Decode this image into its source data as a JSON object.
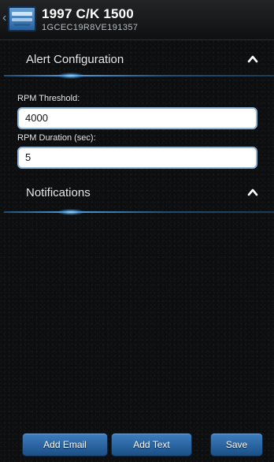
{
  "header": {
    "vehicle_name": "1997 C/K 1500",
    "vin": "1GCEC19R8VE191357"
  },
  "sections": {
    "alert_configuration": {
      "title": "Alert Configuration"
    },
    "notifications": {
      "title": "Notifications"
    }
  },
  "fields": {
    "rpm_threshold": {
      "label": "RPM Threshold:",
      "value": "4000"
    },
    "rpm_duration": {
      "label": "RPM Duration (sec):",
      "value": "5"
    }
  },
  "buttons": {
    "add_email": "Add Email",
    "add_text": "Add Text",
    "save": "Save"
  },
  "colors": {
    "accent": "#4aa0e0",
    "button": "#2a66a4",
    "background": "#0d0e10"
  },
  "icons": {
    "back": "chevron-left-icon",
    "app": "car-dashboard-icon",
    "collapse": "chevron-up-icon"
  }
}
